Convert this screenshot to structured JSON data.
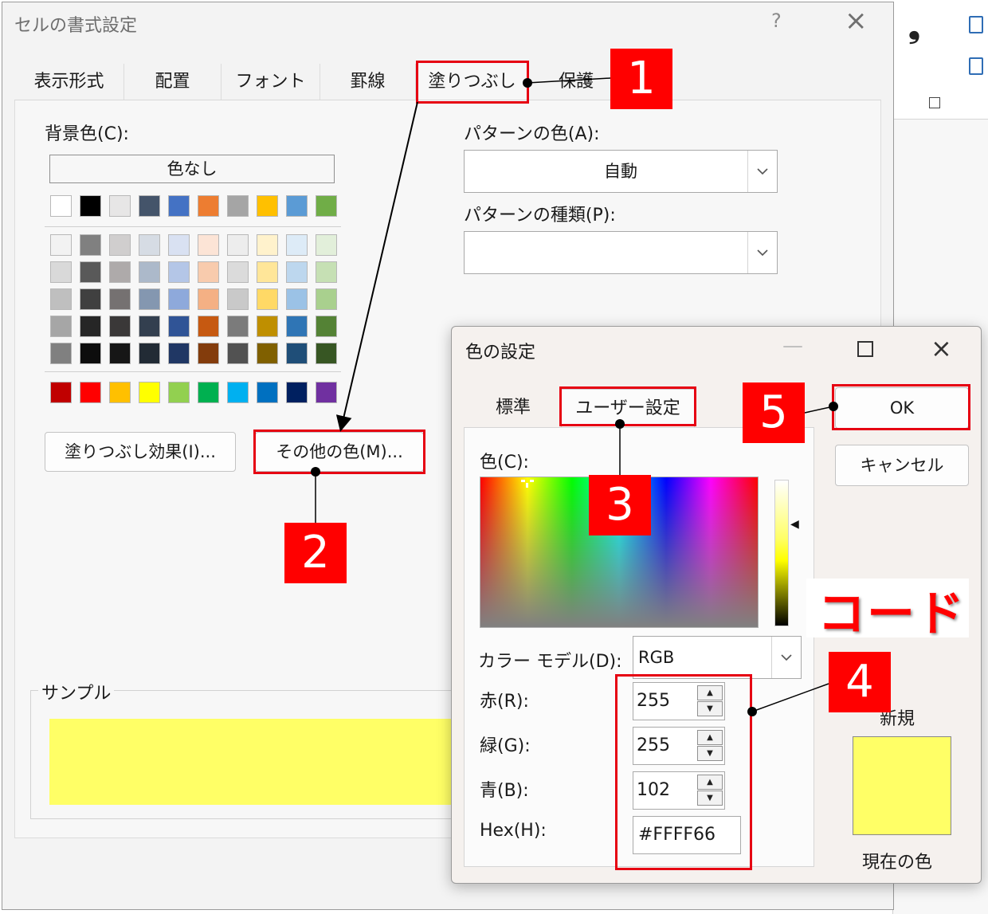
{
  "format_dialog": {
    "title": "セルの書式設定",
    "help": "?",
    "close": "×",
    "tabs": [
      "表示形式",
      "配置",
      "フォント",
      "罫線",
      "塗りつぶし",
      "保護"
    ],
    "background_color_label": "背景色(C):",
    "no_color": "色なし",
    "fill_effects": "塗りつぶし効果(I)...",
    "more_colors": "その他の色(M)...",
    "pattern_color_label": "パターンの色(A):",
    "pattern_color_value": "自動",
    "pattern_type_label": "パターンの種類(P):",
    "sample_label": "サンプル",
    "sample_color": "#FFFF66"
  },
  "palette": {
    "theme_top": [
      "#FFFFFF",
      "#000000",
      "#E7E6E6",
      "#44546A",
      "#4472C4",
      "#ED7D31",
      "#A5A5A5",
      "#FFC000",
      "#5B9BD5",
      "#70AD47"
    ],
    "theme_shades": [
      [
        "#F2F2F2",
        "#808080",
        "#D0CECE",
        "#D6DCE4",
        "#D9E1F2",
        "#FCE4D6",
        "#EDEDED",
        "#FFF2CC",
        "#DDEBF7",
        "#E2EFDA"
      ],
      [
        "#D9D9D9",
        "#595959",
        "#AEAAAA",
        "#ACB9CA",
        "#B4C6E7",
        "#F8CBAD",
        "#DBDBDB",
        "#FFE699",
        "#BDD7EE",
        "#C6E0B4"
      ],
      [
        "#BFBFBF",
        "#404040",
        "#757171",
        "#8497B0",
        "#8EA9DB",
        "#F4B084",
        "#C9C9C9",
        "#FFD966",
        "#9BC2E6",
        "#A9D08E"
      ],
      [
        "#A6A6A6",
        "#262626",
        "#3A3838",
        "#333F4F",
        "#305496",
        "#C65911",
        "#7B7B7B",
        "#BF8F00",
        "#2F75B5",
        "#548235"
      ],
      [
        "#808080",
        "#0D0D0D",
        "#161616",
        "#222B35",
        "#203764",
        "#833C0C",
        "#525252",
        "#806000",
        "#1F4E78",
        "#375623"
      ]
    ],
    "standard": [
      "#C00000",
      "#FF0000",
      "#FFC000",
      "#FFFF00",
      "#92D050",
      "#00B050",
      "#00B0F0",
      "#0070C0",
      "#002060",
      "#7030A0"
    ]
  },
  "color_dialog": {
    "title": "色の設定",
    "minimize": "—",
    "close": "×",
    "tab_standard": "標準",
    "tab_custom": "ユーザー設定",
    "color_label": "色(C):",
    "model_label": "カラー モデル(D):",
    "model_value": "RGB",
    "red_label": "赤(R):",
    "red_value": "255",
    "green_label": "緑(G):",
    "green_value": "255",
    "blue_label": "青(B):",
    "blue_value": "102",
    "hex_label": "Hex(H):",
    "hex_value": "#FFFF66",
    "ok": "OK",
    "cancel": "キャンセル",
    "new_label": "新規",
    "current_label": "現在の色",
    "new_color": "#FFFF66"
  },
  "annotations": {
    "step1": "1",
    "step2": "2",
    "step3": "3",
    "step4": "4",
    "step5": "5",
    "code_label": "コード",
    "highlight_color": "#E60012"
  },
  "excel_background": {
    "comma_icon": "❟"
  }
}
